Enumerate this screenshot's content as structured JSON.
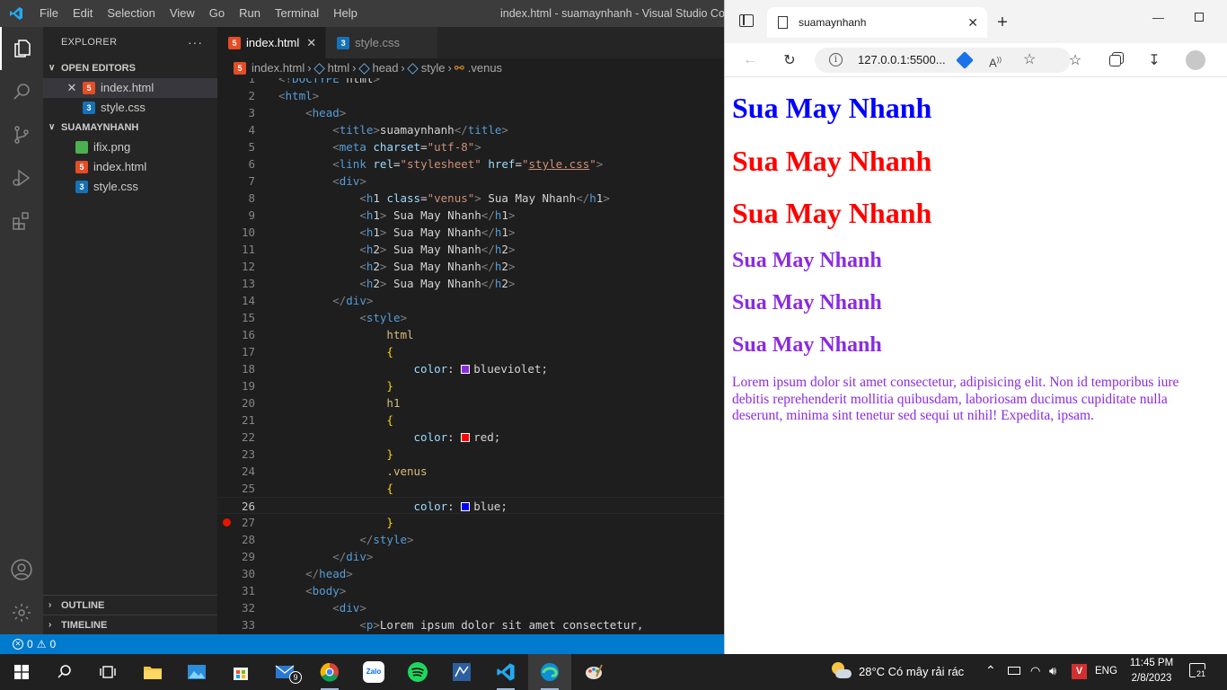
{
  "vscode": {
    "menu": [
      "File",
      "Edit",
      "Selection",
      "View",
      "Go",
      "Run",
      "Terminal",
      "Help"
    ],
    "window_title": "index.html - suamaynhanh - Visual Studio Code",
    "explorer": {
      "title": "EXPLORER",
      "more": "···",
      "open_editors_label": "OPEN EDITORS",
      "open_editors": [
        {
          "name": "index.html",
          "type": "html"
        },
        {
          "name": "style.css",
          "type": "css"
        }
      ],
      "folder_label": "SUAMAYNHANH",
      "files": [
        {
          "name": "ifix.png",
          "type": "png"
        },
        {
          "name": "index.html",
          "type": "html"
        },
        {
          "name": "style.css",
          "type": "css"
        }
      ],
      "outline_label": "OUTLINE",
      "timeline_label": "TIMELINE"
    },
    "tabs": [
      {
        "label": "index.html",
        "type": "html",
        "active": true
      },
      {
        "label": "style.css",
        "type": "css",
        "active": false
      }
    ],
    "breadcrumb": [
      "index.html",
      "html",
      "head",
      "style",
      ".venus"
    ],
    "status": {
      "errors": "0",
      "warnings": "0"
    },
    "code_lines": [
      "<!DOCTYPE html>",
      "<html>",
      "    <head>",
      "        <title>suamaynhanh</title>",
      "        <meta charset=\"utf-8\">",
      "        <link rel=\"stylesheet\" href=\"style.css\">",
      "        <div>",
      "            <h1 class=\"venus\"> Sua May Nhanh</h1>",
      "            <h1> Sua May Nhanh</h1>",
      "            <h1> Sua May Nhanh</h1>",
      "            <h2> Sua May Nhanh</h2>",
      "            <h2> Sua May Nhanh</h2>",
      "            <h2> Sua May Nhanh</h2>",
      "        </div>",
      "            <style>",
      "                html",
      "                {",
      "                    color: blueviolet;",
      "                }",
      "                h1",
      "                {",
      "                    color: red;",
      "                }",
      "                .venus",
      "                {",
      "                    color: blue;",
      "                }",
      "            </style>",
      "        </div>",
      "    </head>",
      "    <body>",
      "        <div>",
      "            <p>Lorem ipsum dolor sit amet consectetur,"
    ],
    "current_line": 26,
    "breakpoint_line": 27,
    "swatch_colors": {
      "blueviolet": "#8a2be2",
      "red": "#ff0000",
      "blue": "#0000ff"
    }
  },
  "browser": {
    "tab_title": "suamaynhanh",
    "url": "127.0.0.1:5500...",
    "headings": [
      {
        "tag": "h1",
        "text": "Sua May Nhanh",
        "color": "#0000ff"
      },
      {
        "tag": "h1",
        "text": "Sua May Nhanh",
        "color": "#ff0000"
      },
      {
        "tag": "h1",
        "text": "Sua May Nhanh",
        "color": "#ff0000"
      },
      {
        "tag": "h2",
        "text": "Sua May Nhanh",
        "color": "#8a2be2"
      },
      {
        "tag": "h2",
        "text": "Sua May Nhanh",
        "color": "#8a2be2"
      },
      {
        "tag": "h2",
        "text": "Sua May Nhanh",
        "color": "#8a2be2"
      }
    ],
    "paragraph": "Lorem ipsum dolor sit amet consectetur, adipisicing elit. Non id temporibus iure debitis reprehenderit mollitia quibusdam, laboriosam ducimus cupiditate nulla deserunt, minima sint tenetur sed sequi ut nihil! Expedita, ipsam."
  },
  "taskbar": {
    "weather": "28°C  Có mây rải rác",
    "language": "ENG",
    "time": "11:45 PM",
    "date": "2/8/2023",
    "notifications": "21",
    "mail_badge": "9"
  },
  "colors": {
    "vscode_accent": "#007acc",
    "html_icon": "#e44d26",
    "css_icon": "#1572b6"
  }
}
